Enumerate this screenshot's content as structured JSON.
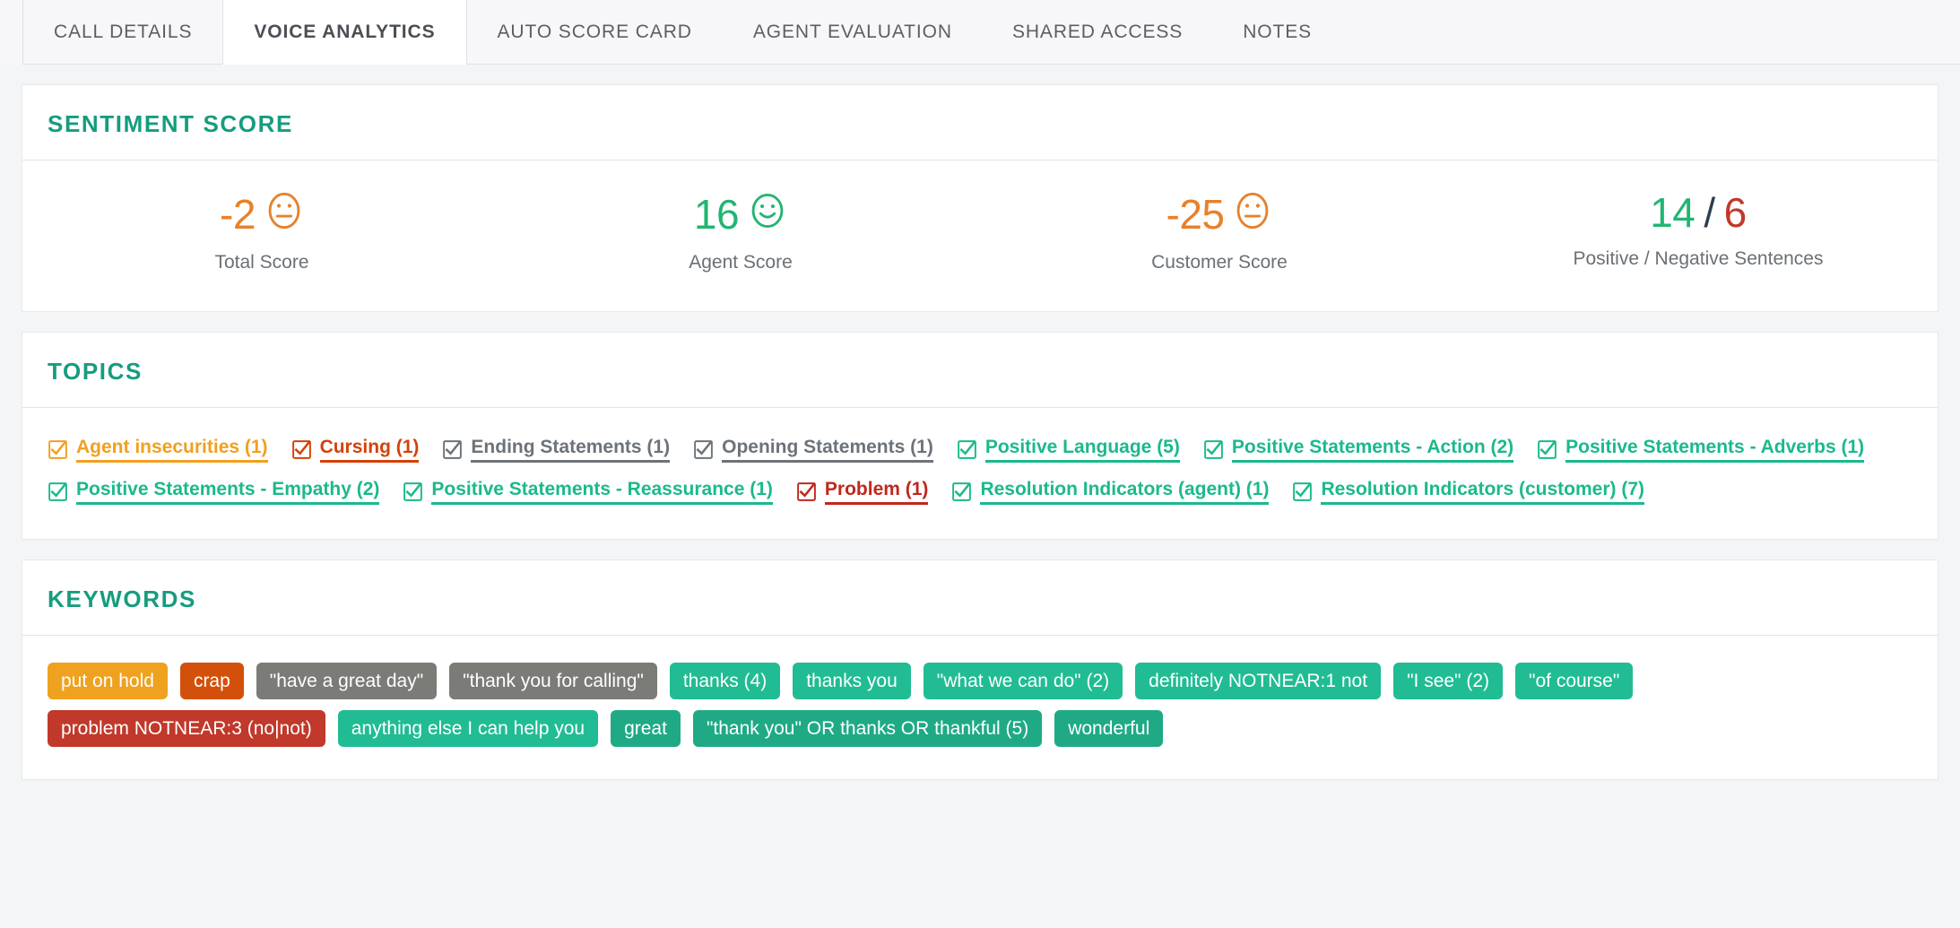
{
  "tabs": [
    {
      "label": "CALL DETAILS",
      "active": false
    },
    {
      "label": "VOICE ANALYTICS",
      "active": true
    },
    {
      "label": "AUTO SCORE CARD",
      "active": false
    },
    {
      "label": "AGENT EVALUATION",
      "active": false
    },
    {
      "label": "SHARED ACCESS",
      "active": false
    },
    {
      "label": "NOTES",
      "active": false
    }
  ],
  "sentiment": {
    "title": "SENTIMENT SCORE",
    "scores": [
      {
        "value": "-2",
        "label": "Total Score",
        "color": "#e8812a",
        "face": "neutral-face-icon"
      },
      {
        "value": "16",
        "label": "Agent Score",
        "color": "#22b573",
        "face": "smiling-face-icon"
      },
      {
        "value": "-25",
        "label": "Customer Score",
        "color": "#e8812a",
        "face": "neutral-face-icon"
      }
    ],
    "ratio": {
      "positive": "14",
      "separator": "/",
      "negative": "6",
      "label": "Positive / Negative Sentences",
      "positive_color": "#22b573",
      "separator_color": "#2c3e50",
      "negative_color": "#c0392b"
    }
  },
  "topics": {
    "title": "TOPICS",
    "items": [
      {
        "label": "Agent insecurities (1)",
        "color": "#f0a020"
      },
      {
        "label": "Cursing (1)",
        "color": "#d3410a"
      },
      {
        "label": "Ending Statements (1)",
        "color": "#6d7378"
      },
      {
        "label": "Opening Statements (1)",
        "color": "#6d7378"
      },
      {
        "label": "Positive Language (5)",
        "color": "#1bb98c"
      },
      {
        "label": "Positive Statements - Action (2)",
        "color": "#1bb98c"
      },
      {
        "label": "Positive Statements - Adverbs (1)",
        "color": "#1bb98c"
      },
      {
        "label": "Positive Statements - Empathy (2)",
        "color": "#1bb98c"
      },
      {
        "label": "Positive Statements - Reassurance (1)",
        "color": "#1bb98c"
      },
      {
        "label": "Problem (1)",
        "color": "#c0271c"
      },
      {
        "label": "Resolution Indicators (agent) (1)",
        "color": "#1bb98c"
      },
      {
        "label": "Resolution Indicators (customer) (7)",
        "color": "#1bb98c"
      }
    ]
  },
  "keywords": {
    "title": "KEYWORDS",
    "items": [
      {
        "label": "put on hold",
        "color": "#efa220"
      },
      {
        "label": "crap",
        "color": "#d3500a"
      },
      {
        "label": "\"have a great day\"",
        "color": "#7b7b78"
      },
      {
        "label": "\"thank you for calling\"",
        "color": "#7b7b78"
      },
      {
        "label": "thanks (4)",
        "color": "#21bc93"
      },
      {
        "label": "thanks you",
        "color": "#21bc93"
      },
      {
        "label": "\"what we can do\" (2)",
        "color": "#21bc93"
      },
      {
        "label": "definitely NOTNEAR:1 not",
        "color": "#21bc93"
      },
      {
        "label": "\"I see\" (2)",
        "color": "#21bc93"
      },
      {
        "label": "\"of course\"",
        "color": "#21bc93"
      },
      {
        "label": "problem NOTNEAR:3 (no|not)",
        "color": "#c0392b"
      },
      {
        "label": "anything else I can help you",
        "color": "#21bc93"
      },
      {
        "label": "great",
        "color": "#1faa85"
      },
      {
        "label": "\"thank you\" OR thanks OR thankful (5)",
        "color": "#1faa85"
      },
      {
        "label": "wonderful",
        "color": "#1faa85"
      }
    ]
  }
}
